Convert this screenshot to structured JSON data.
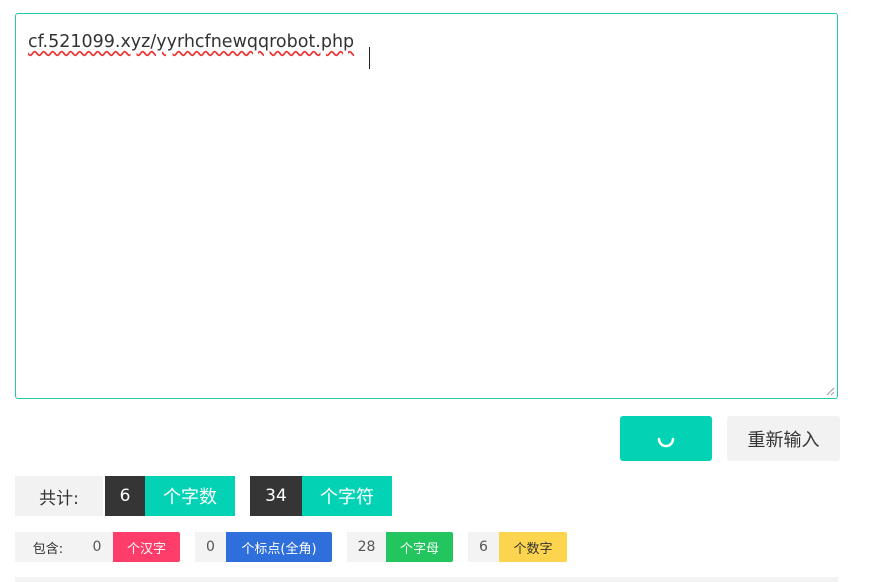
{
  "editor": {
    "value": "cf.521099.xyz/yyrhcfnewqqrobot.php"
  },
  "buttons": {
    "submit_icon": "loading-spinner-icon",
    "reset_label": "重新输入"
  },
  "summary": {
    "label": "共计:",
    "word_count": "6",
    "word_unit": "个字数",
    "char_count": "34",
    "char_unit": "个字符"
  },
  "breakdown": {
    "label": "包含:",
    "items": [
      {
        "count": "0",
        "label": "个汉字",
        "color": "#ff3d6a"
      },
      {
        "count": "0",
        "label": "个标点(全角)",
        "color": "#2f6fdb"
      },
      {
        "count": "28",
        "label": "个字母",
        "color": "#22c55e"
      },
      {
        "count": "6",
        "label": "个数字",
        "color": "#fcd44d"
      }
    ]
  },
  "colors": {
    "accent": "#03d2b5",
    "dark": "#353535"
  }
}
